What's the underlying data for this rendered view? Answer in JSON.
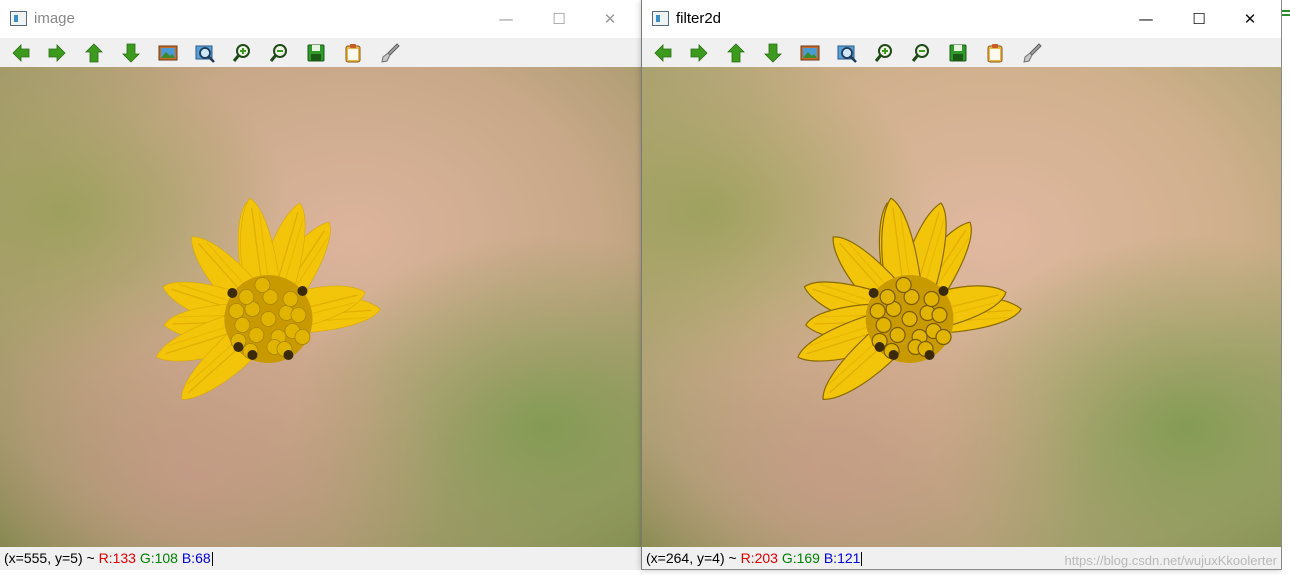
{
  "windows": [
    {
      "title": "image",
      "status": {
        "coords": "(x=555, y=5) ~ ",
        "r": "R:133",
        "g": "G:108",
        "b": "B:68"
      }
    },
    {
      "title": "filter2d",
      "status": {
        "coords": "(x=264, y=4) ~ ",
        "r": "R:203",
        "g": "G:169",
        "b": "B:121"
      },
      "watermark": "https://blog.csdn.net/wujuxKkoolerter"
    }
  ],
  "titlebar_buttons": {
    "minimize": "—",
    "maximize": "☐",
    "close": "✕"
  },
  "toolbar": [
    {
      "name": "pan-left-icon"
    },
    {
      "name": "pan-right-icon"
    },
    {
      "name": "pan-up-icon"
    },
    {
      "name": "pan-down-icon"
    },
    {
      "name": "zoom-original-icon"
    },
    {
      "name": "zoom-fit-icon"
    },
    {
      "name": "zoom-in-icon"
    },
    {
      "name": "zoom-out-icon"
    },
    {
      "name": "save-icon"
    },
    {
      "name": "copy-clipboard-icon"
    },
    {
      "name": "properties-brush-icon"
    }
  ],
  "colors": {
    "arrow_green": "#3c9a1e",
    "status_red": "#e00000",
    "status_green": "#008000",
    "status_blue": "#0000e0",
    "petal_yellow": "#f2c40a"
  }
}
